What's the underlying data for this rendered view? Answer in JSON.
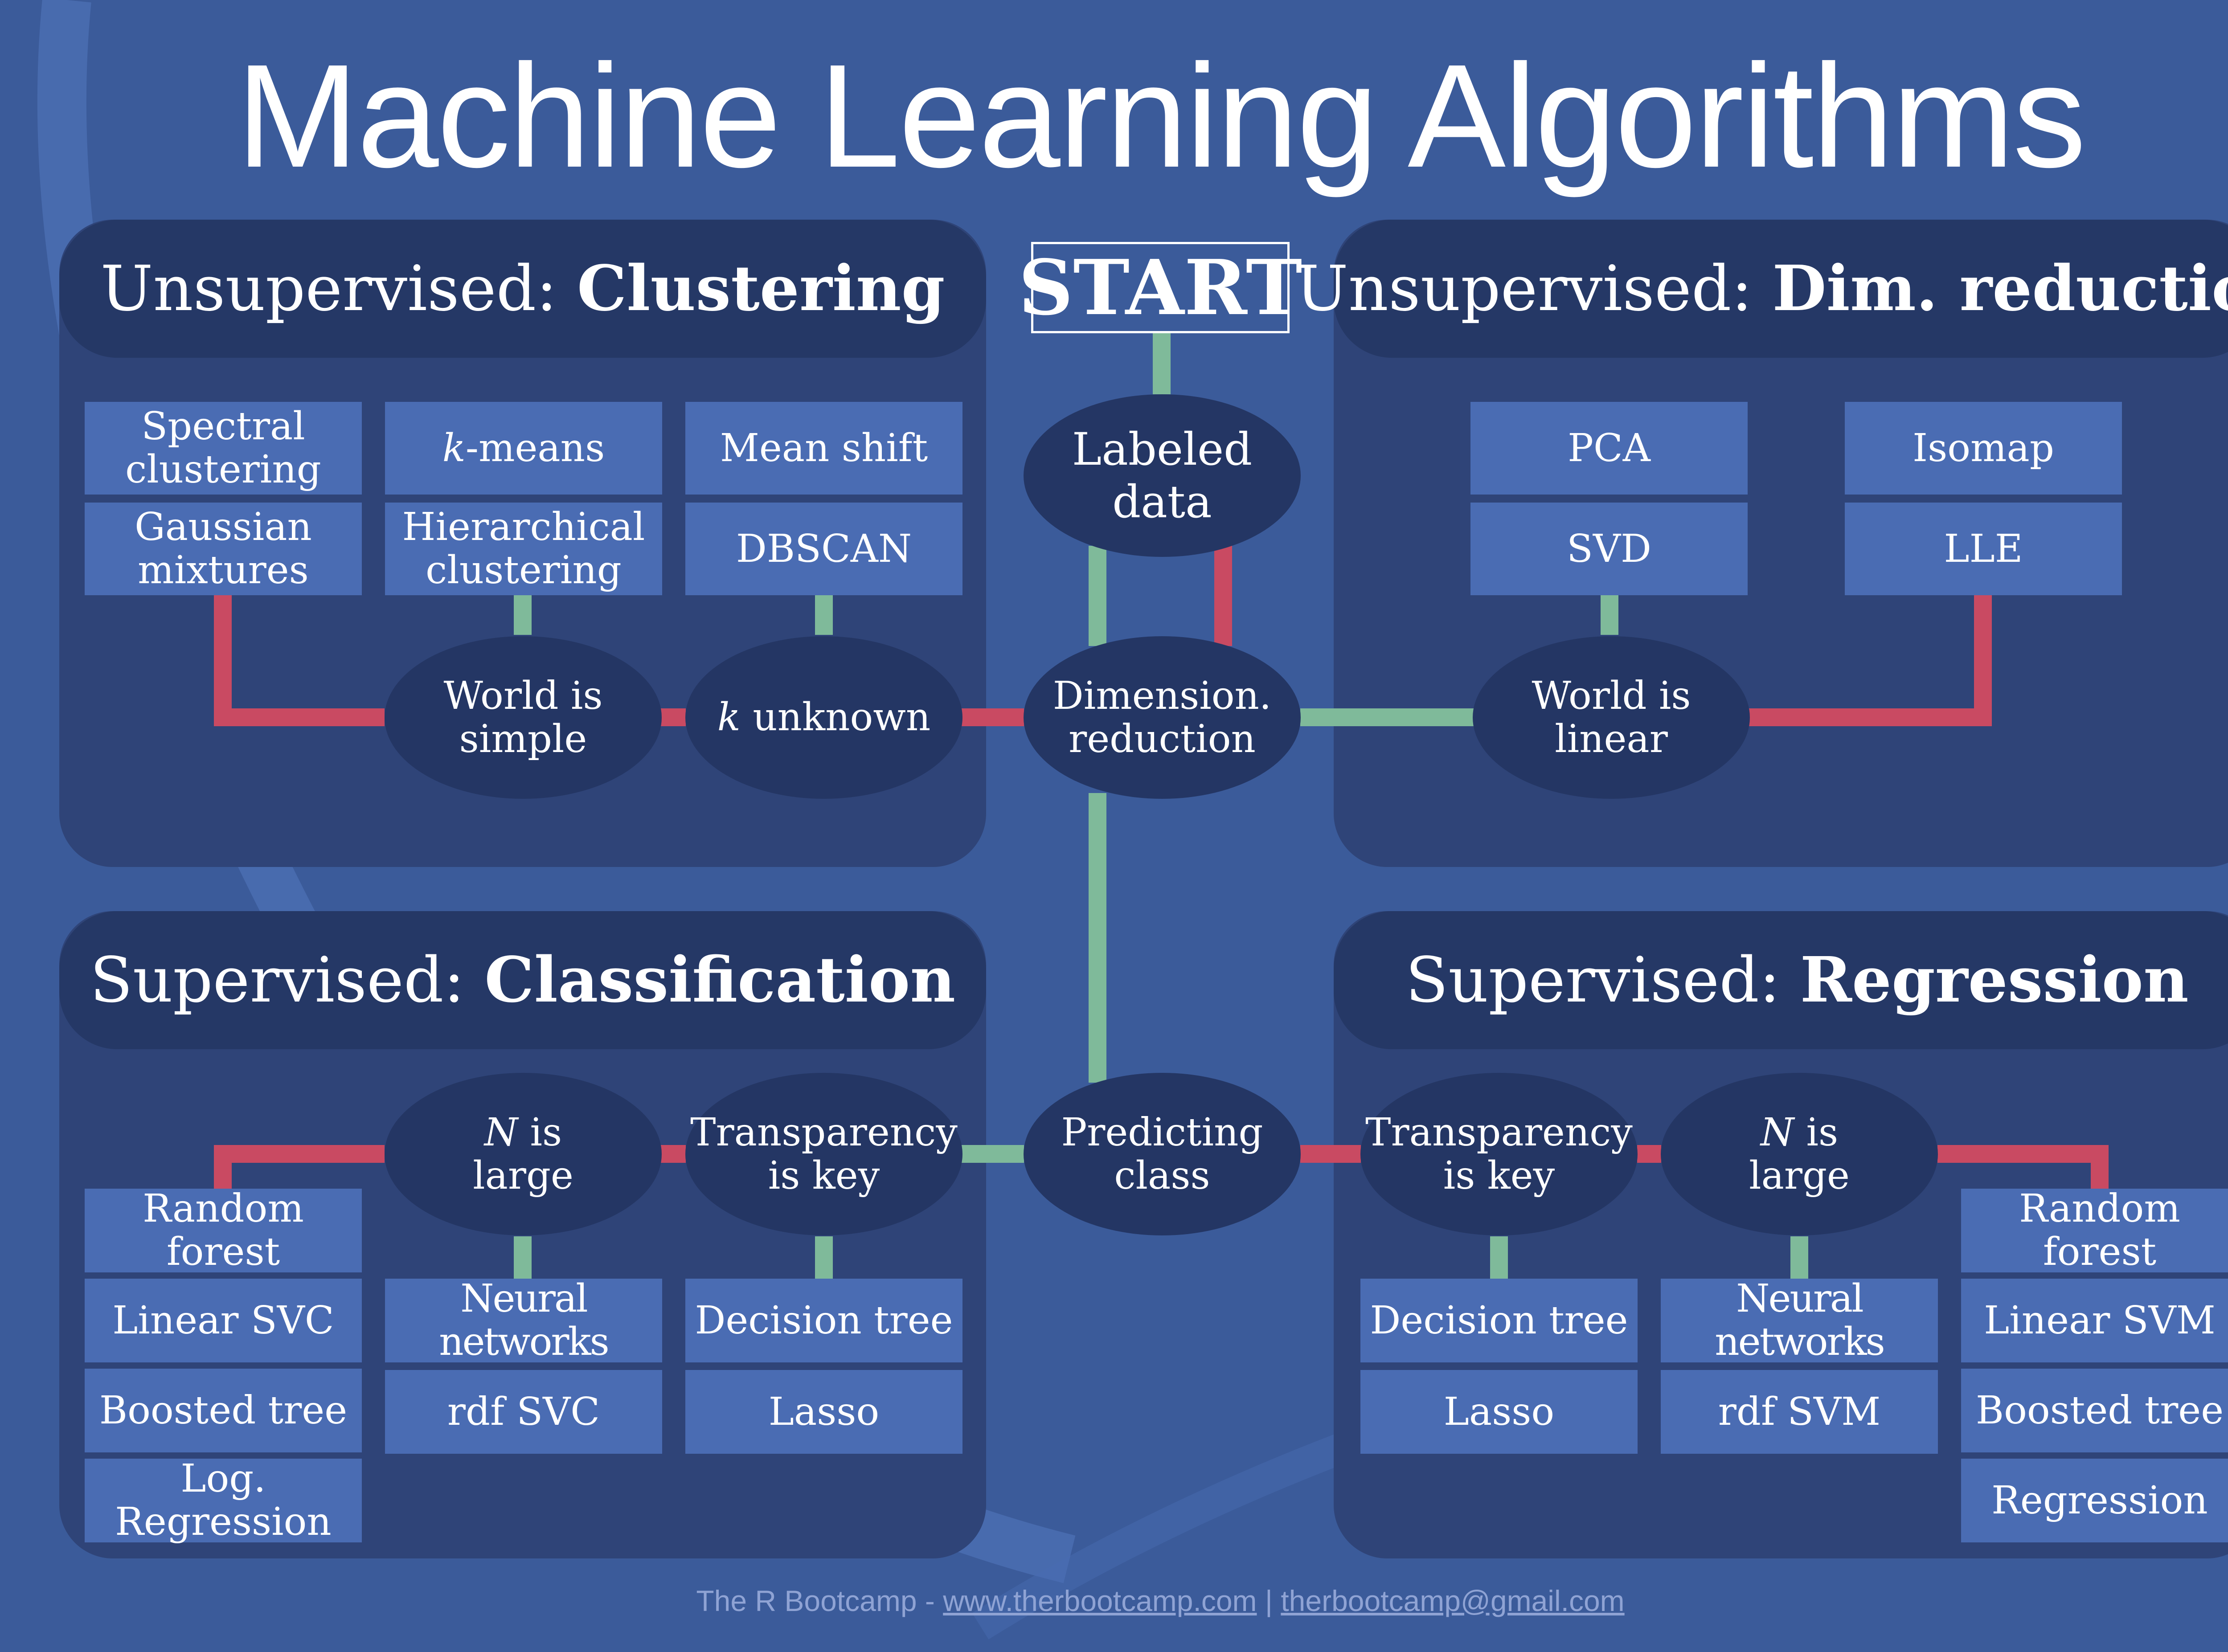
{
  "title": "Machine Learning Algorithms",
  "start_label": "START",
  "colors": {
    "background": "#3b5b9a",
    "panel": "#2f4478",
    "header": "#253866",
    "box": "#4a6cb3",
    "node": "#243664",
    "line_green": "#7fba9a",
    "line_red": "#c94a62"
  },
  "panels": {
    "clustering": {
      "prefix": "Unsupervised: ",
      "name": "Clustering"
    },
    "dimred": {
      "prefix": "Unsupervised: ",
      "name": "Dim. reduction"
    },
    "classification": {
      "prefix": "Supervised: ",
      "name": "Classification"
    },
    "regression": {
      "prefix": "Supervised: ",
      "name": "Regression"
    }
  },
  "nodes": {
    "labeled": "Labeled\ndata",
    "dimension": "Dimension.\nreduction",
    "predicting": "Predicting\nclass",
    "clu_world": "World is\nsimple",
    "clu_k_var": "k",
    "clu_k_rest": " unknown",
    "dim_world": "World is\nlinear",
    "cls_n_var": "N",
    "cls_n_rest": " is\nlarge",
    "cls_transp": "Transparency\nis key",
    "reg_transp": "Transparency\nis key",
    "reg_n_var": "N",
    "reg_n_rest": " is\nlarge"
  },
  "boxes": {
    "spectral": "Spectral\nclustering",
    "kmeans_var": "k",
    "kmeans_rest": "-means",
    "meanshift": "Mean shift",
    "gaussian": "Gaussian\nmixtures",
    "hierarchical": "Hierarchical\nclustering",
    "dbscan": "DBSCAN",
    "pca": "PCA",
    "isomap": "Isomap",
    "svd": "SVD",
    "lle": "LLE",
    "cls_rf": "Random forest",
    "cls_linsvc": "Linear SVC",
    "cls_boosted": "Boosted tree",
    "cls_logreg": "Log. Regression",
    "cls_nn": "Neural networks",
    "cls_rdf": "rdf SVC",
    "cls_dtree": "Decision tree",
    "cls_lasso": "Lasso",
    "reg_dtree": "Decision tree",
    "reg_lasso": "Lasso",
    "reg_nn": "Neural networks",
    "reg_rdf": "rdf SVM",
    "reg_rf": "Random forest",
    "reg_linsvm": "Linear SVM",
    "reg_boosted": "Boosted tree",
    "reg_regression": "Regression"
  },
  "footer": {
    "prefix": "The R Bootcamp - ",
    "website": "www.therbootcamp.com",
    "separator": " | ",
    "email": "therbootcamp@gmail.com"
  }
}
